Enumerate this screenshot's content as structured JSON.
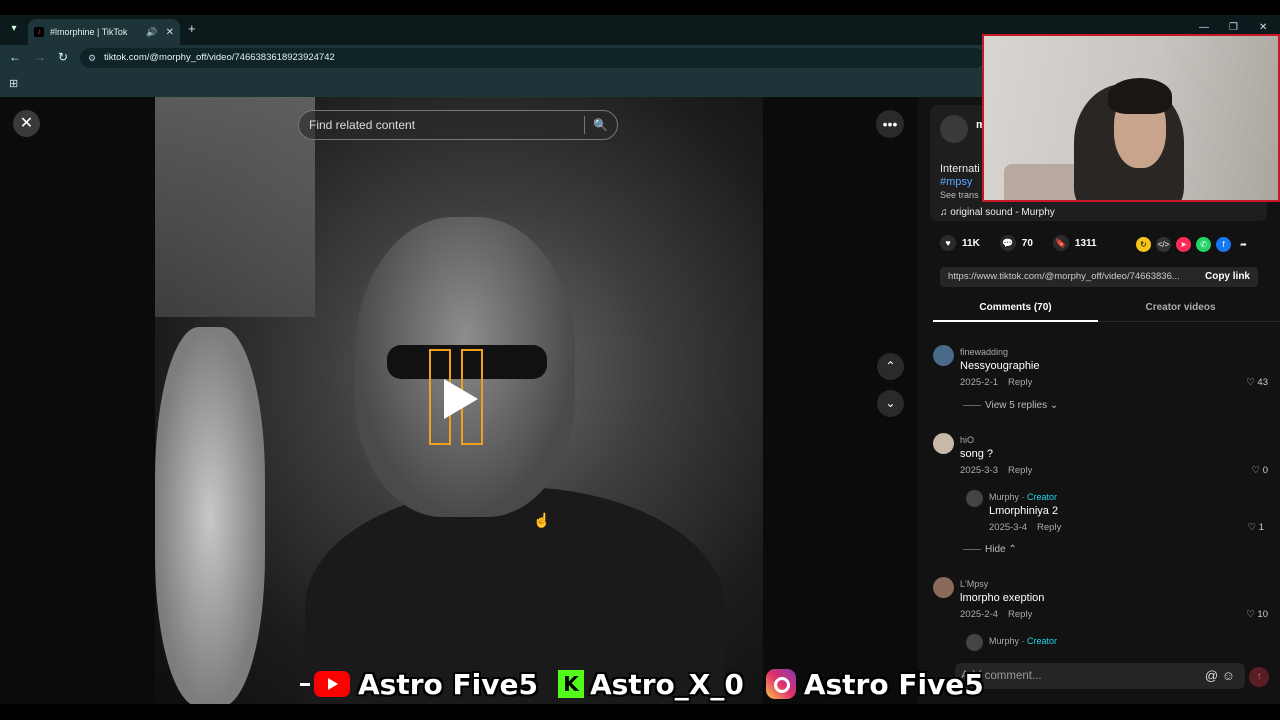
{
  "browser": {
    "tab_title": "#lmorphine | TikTok",
    "url": "tiktok.com/@morphy_off/video/7466383618923924742"
  },
  "player": {
    "search_placeholder": "Find related content"
  },
  "post": {
    "author_initial": "m",
    "description": "Internati",
    "hashtag": "#mpsy",
    "see_translation": "See trans",
    "sound": "original sound - Murphy"
  },
  "stats": {
    "likes": "11K",
    "comments": "70",
    "saves": "1311"
  },
  "share_link": {
    "url": "https://www.tiktok.com/@morphy_off/video/74663836...",
    "copy_label": "Copy link"
  },
  "tabs": {
    "comments": "Comments (70)",
    "creator_videos": "Creator videos"
  },
  "comments": [
    {
      "user": "finewadding",
      "text": "Nessyougraphie",
      "date": "2025-2-1",
      "reply": "Reply",
      "likes": "43",
      "view_replies": "View 5 replies"
    },
    {
      "user": "hiO",
      "text": "song ?",
      "date": "2025-3-3",
      "reply": "Reply",
      "likes": "0"
    },
    {
      "user": "L'Mpsy",
      "text": "lmorpho exeption",
      "date": "2025-2-4",
      "reply": "Reply",
      "likes": "10"
    }
  ],
  "creator_reply": {
    "user": "Murphy",
    "badge": "Creator",
    "text": "Lmorphiniya 2",
    "date": "2025-3-4",
    "reply": "Reply",
    "likes": "1",
    "hide": "Hide"
  },
  "creator_reply_2": {
    "user": "Murphy",
    "badge": "Creator"
  },
  "add_comment_placeholder": "Add comment...",
  "socials": {
    "youtube": "Astro Five5",
    "kick": "Astro_X_0",
    "instagram": "Astro Five5"
  },
  "colors": {
    "accent": "#fe2c55",
    "hashtag": "#5aa7ff",
    "creator": "#20d5ec",
    "webcam_border": "#c81828"
  }
}
